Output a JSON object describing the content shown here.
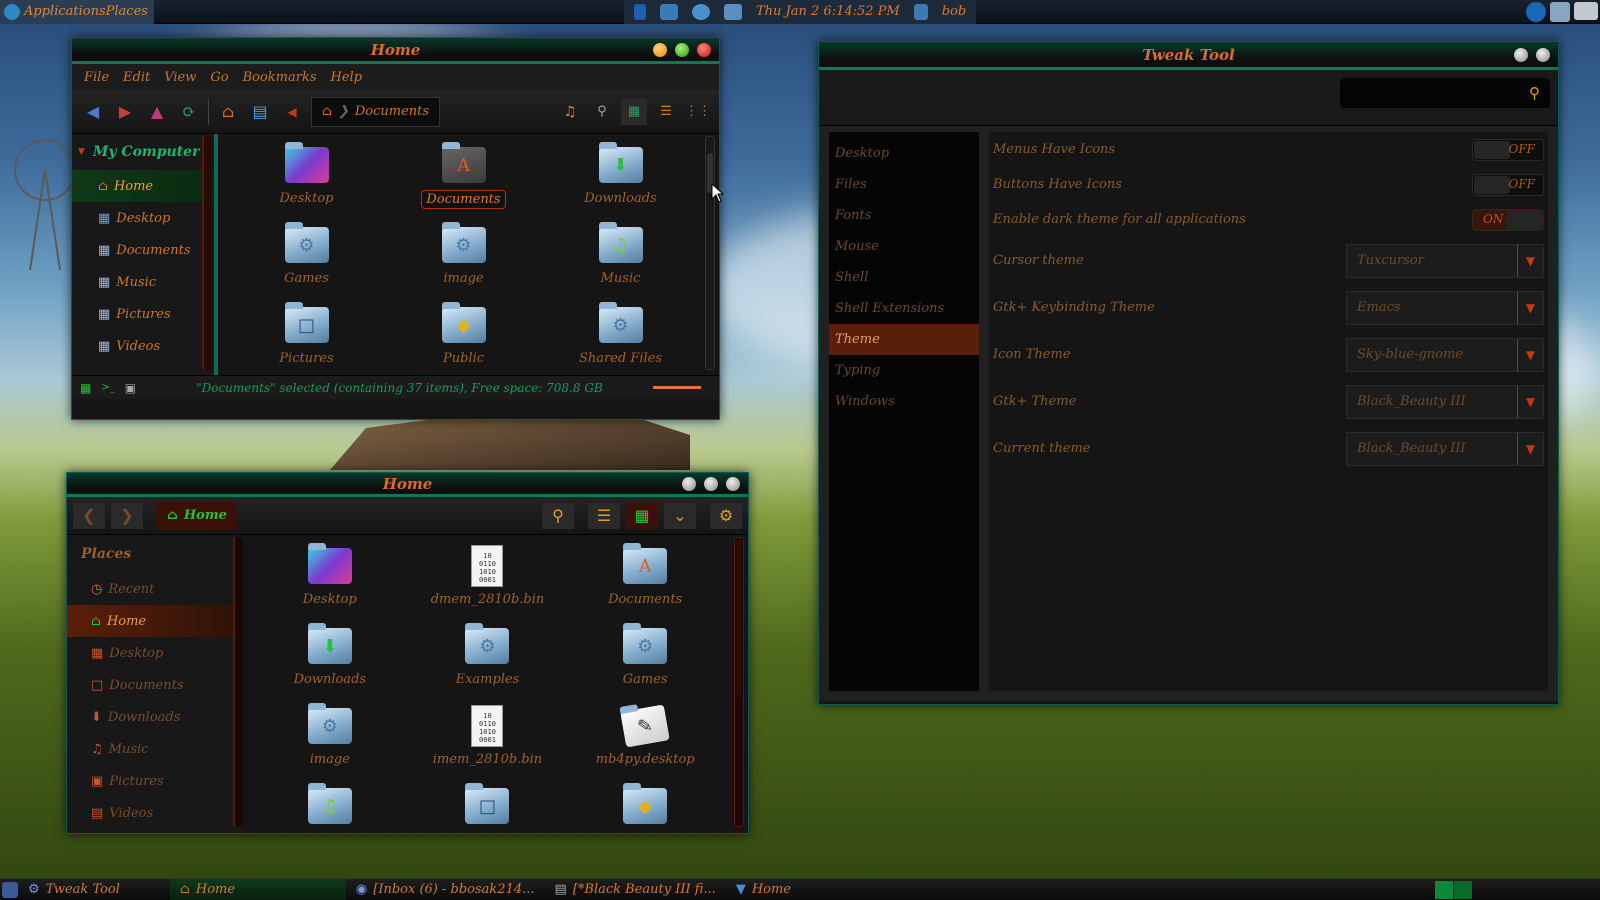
{
  "top_panel": {
    "menu_label": "ApplicationsPlaces",
    "clock": "Thu Jan  2   6:14:52 PM",
    "user": "bob"
  },
  "caja": {
    "title": "Home",
    "menu": [
      "File",
      "Edit",
      "View",
      "Go",
      "Bookmarks",
      "Help"
    ],
    "breadcrumb": "Documents",
    "sidebar_header": "My Computer",
    "sidebar": [
      "Home",
      "Desktop",
      "Documents",
      "Music",
      "Pictures",
      "Videos"
    ],
    "items": [
      "Desktop",
      "Documents",
      "Downloads",
      "Games",
      "image",
      "Music",
      "Pictures",
      "Public",
      "Shared Files"
    ],
    "status": "\"Documents\" selected (containing 37 items), Free space: 708.8 GB"
  },
  "nautilus": {
    "title": "Home",
    "path": "Home",
    "places_header": "Places",
    "sidebar": [
      "Recent",
      "Home",
      "Desktop",
      "Documents",
      "Downloads",
      "Music",
      "Pictures",
      "Videos"
    ],
    "items": [
      "Desktop",
      "dmem_2810b.bin",
      "Documents",
      "Downloads",
      "Examples",
      "Games",
      "image",
      "imem_2810b.bin",
      "mb4py.desktop",
      "",
      "",
      ""
    ]
  },
  "tweak": {
    "title": "Tweak Tool",
    "sidebar": [
      "Desktop",
      "Files",
      "Fonts",
      "Mouse",
      "Shell",
      "Shell Extensions",
      "Theme",
      "Typing",
      "Windows"
    ],
    "rows": [
      {
        "label": "Menus Have Icons",
        "state": "OFF"
      },
      {
        "label": "Buttons Have Icons",
        "state": "OFF"
      },
      {
        "label": "Enable dark theme for all applications",
        "state": "ON"
      }
    ],
    "combos": [
      {
        "label": "Cursor theme",
        "value": "Tuxcursor"
      },
      {
        "label": "Gtk+ Keybinding Theme",
        "value": "Emacs"
      },
      {
        "label": "Icon Theme",
        "value": "Sky-blue-gnome"
      },
      {
        "label": "Gtk+ Theme",
        "value": "Black_Beauty III"
      },
      {
        "label": "Current theme",
        "value": "Black_Beauty III"
      }
    ]
  },
  "taskbar": [
    "Tweak Tool",
    "Home",
    "[Inbox (6) - bbosak214...",
    "[*Black Beauty III fi...",
    "Home"
  ],
  "colors": {
    "accent": "#c9762f",
    "green": "#0e7a54",
    "selected": "#5a1f0a"
  }
}
